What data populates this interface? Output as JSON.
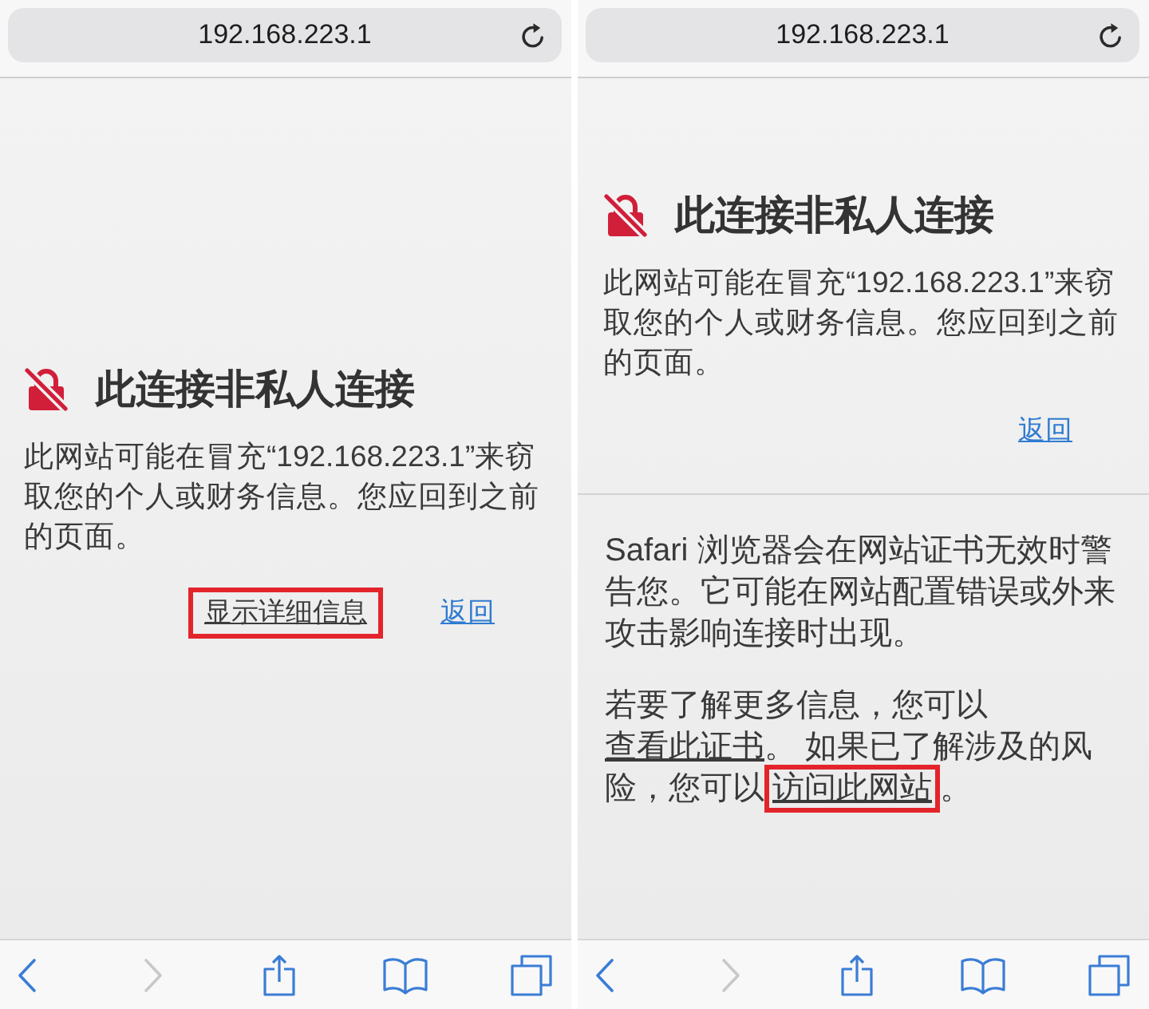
{
  "panels": [
    {
      "address_bar": {
        "url": "192.168.223.1"
      },
      "warning": {
        "title": "此连接非私人连接",
        "message": "此网站可能在冒充“192.168.223.1”来窃取您的个人或财务信息。您应回到之前的页面。"
      },
      "links": [
        {
          "label": "显示详细信息",
          "kind": "details",
          "highlighted": true
        },
        {
          "label": "返回",
          "kind": "back",
          "highlighted": false
        }
      ],
      "toolbar": [
        {
          "kind": "back",
          "disabled": false
        },
        {
          "kind": "forward",
          "disabled": true
        },
        {
          "kind": "share",
          "disabled": false
        },
        {
          "kind": "bookmarks",
          "disabled": false
        },
        {
          "kind": "tabs",
          "disabled": false
        }
      ]
    },
    {
      "address_bar": {
        "url": "192.168.223.1"
      },
      "warning": {
        "title": "此连接非私人连接",
        "message": "此网站可能在冒充“192.168.223.1”来窃取您的个人或财务信息。您应回到之前的页面。"
      },
      "links": [
        {
          "label": "返回",
          "kind": "back",
          "highlighted": false
        }
      ],
      "details": [
        {
          "segments": [
            {
              "kind": "text",
              "text": "Safari 浏览器会在网站证书无效时警告您。它可能在网站配置错误或外来攻击影响连接时出现。"
            }
          ]
        },
        {
          "segments": [
            {
              "kind": "text",
              "text": "若要了解更多信息，您可以"
            },
            {
              "kind": "link",
              "text": "查看此证书",
              "highlighted": false
            },
            {
              "kind": "text",
              "text": "。 如果已了解涉及的风险，您可以"
            },
            {
              "kind": "link",
              "text": "访问此网站",
              "highlighted": true
            },
            {
              "kind": "text",
              "text": "。"
            }
          ]
        }
      ],
      "toolbar": [
        {
          "kind": "back",
          "disabled": false
        },
        {
          "kind": "forward",
          "disabled": true
        },
        {
          "kind": "share",
          "disabled": false
        },
        {
          "kind": "bookmarks",
          "disabled": false
        },
        {
          "kind": "tabs",
          "disabled": false
        }
      ]
    }
  ]
}
